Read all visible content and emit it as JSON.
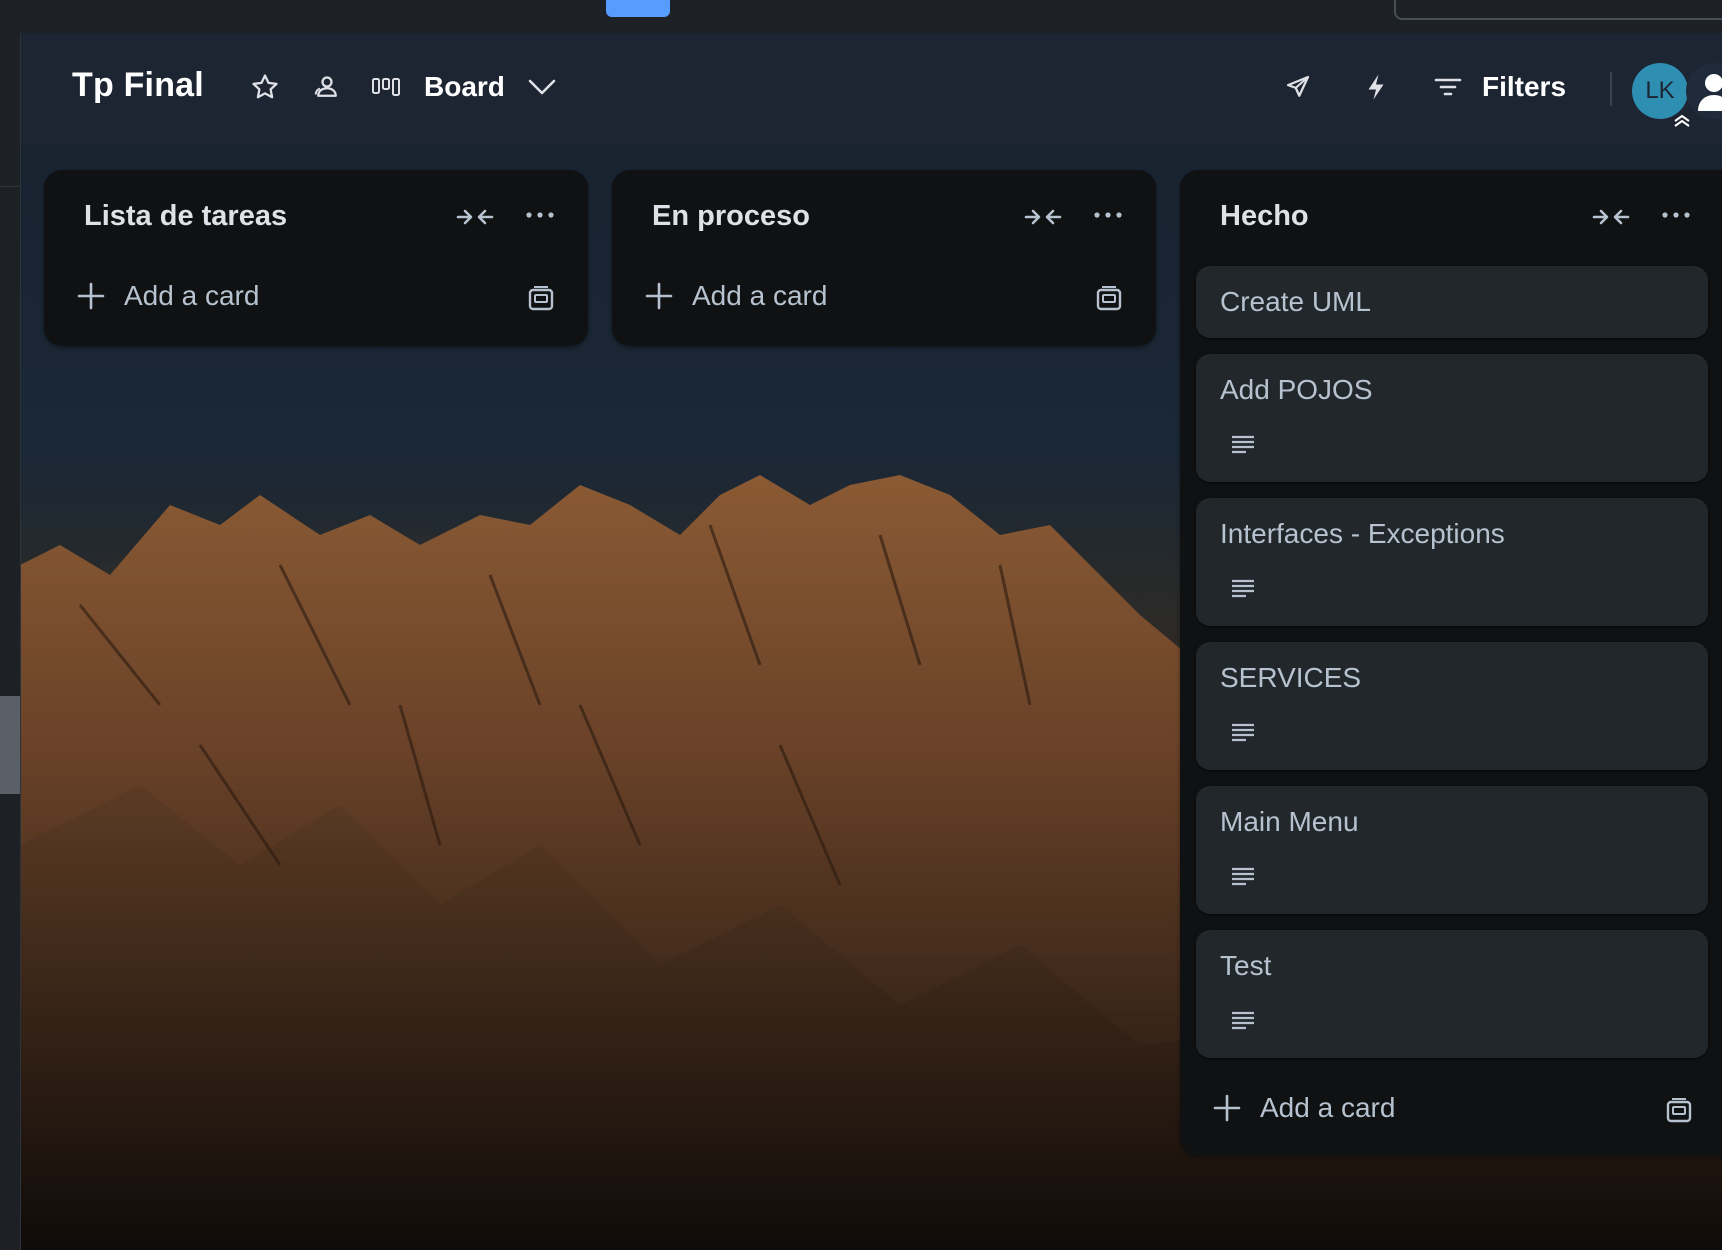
{
  "board": {
    "title": "Tp Final",
    "view": "Board",
    "filters_label": "Filters",
    "member_initials": "LK"
  },
  "lists": [
    {
      "title": "Lista de tareas",
      "add_label": "Add a card",
      "cards": []
    },
    {
      "title": "En proceso",
      "add_label": "Add a card",
      "cards": []
    },
    {
      "title": "Hecho",
      "add_label": "Add a card",
      "cards": [
        {
          "title": "Create UML",
          "has_description": false
        },
        {
          "title": "Add POJOS",
          "has_description": true
        },
        {
          "title": "Interfaces - Exceptions",
          "has_description": true
        },
        {
          "title": "SERVICES",
          "has_description": true
        },
        {
          "title": "Main Menu",
          "has_description": true
        },
        {
          "title": "Test",
          "has_description": true
        }
      ]
    }
  ],
  "icons": {
    "star": "star-icon",
    "members": "members-icon",
    "board_view": "board-view-icon",
    "chevron": "chevron-down-icon",
    "power_ups": "rocket-icon",
    "automation": "lightning-icon",
    "filter": "filter-icon",
    "collapse": "collapse-icon",
    "more": "more-icon",
    "add": "plus-icon",
    "template": "card-template-icon",
    "description": "description-icon"
  },
  "colors": {
    "header_bg": "#1d2532",
    "list_bg": "#0f1112",
    "card_bg": "#22272b",
    "avatar_bg": "#2e8fb3",
    "accent": "#579dff"
  }
}
